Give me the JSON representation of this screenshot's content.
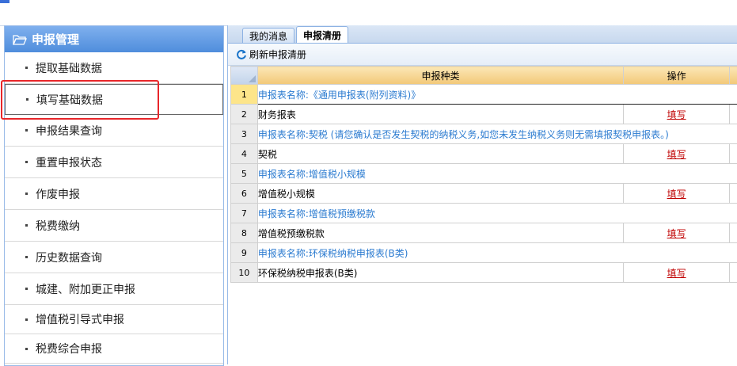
{
  "sidebar": {
    "title": "申报管理",
    "items": [
      {
        "label": "提取基础数据"
      },
      {
        "label": "填写基础数据"
      },
      {
        "label": "申报结果查询"
      },
      {
        "label": "重置申报状态"
      },
      {
        "label": "作废申报"
      },
      {
        "label": "税费缴纳"
      },
      {
        "label": "历史数据查询"
      },
      {
        "label": "城建、附加更正申报"
      },
      {
        "label": "增值税引导式申报"
      },
      {
        "label": "税费综合申报"
      }
    ]
  },
  "tabs": [
    {
      "label": "我的消息"
    },
    {
      "label": "申报清册"
    }
  ],
  "toolbar": {
    "refresh_label": "刷新申报清册"
  },
  "grid": {
    "headers": {
      "type": "申报种类",
      "action": "操作"
    },
    "rows": [
      {
        "num": "1",
        "text": "申报表名称:《通用申报表(附列资料)》"
      },
      {
        "num": "2",
        "text": "财务报表",
        "action": "填写"
      },
      {
        "num": "3",
        "text": "申报表名称:契税 (请您确认是否发生契税的纳税义务,如您未发生纳税义务则无需填报契税申报表。)"
      },
      {
        "num": "4",
        "text": "契税",
        "action": "填写"
      },
      {
        "num": "5",
        "text": "申报表名称:增值税小规模"
      },
      {
        "num": "6",
        "text": "增值税小规模",
        "action": "填写"
      },
      {
        "num": "7",
        "text": "申报表名称:增值税预缴税款"
      },
      {
        "num": "8",
        "text": "增值税预缴税款",
        "action": "填写"
      },
      {
        "num": "9",
        "text": "申报表名称:环保税纳税申报表(B类)"
      },
      {
        "num": "10",
        "text": "环保税纳税申报表(B类)",
        "action": "填写"
      }
    ]
  },
  "colors": {
    "accent": "#4f8ddc",
    "section_text": "#2b7bd0",
    "action_link": "#c00000",
    "highlight": "#e8262a"
  }
}
